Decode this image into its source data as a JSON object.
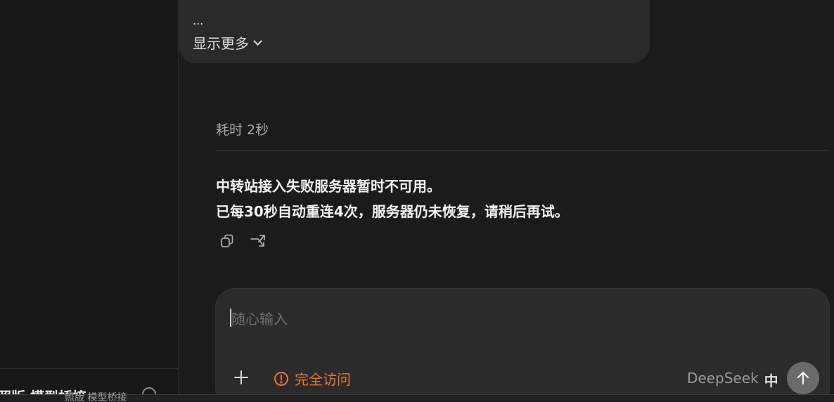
{
  "sidebar": {
    "bottom_label": "照版 模型桥接"
  },
  "taskbar": {
    "strip_text": "照版 模型桥接"
  },
  "previous_message": {
    "ellipsis": "...",
    "show_more": "显示更多"
  },
  "response": {
    "elapsed": "耗时 2秒",
    "lines": [
      "中转站接入失败服务器暂时不可用。",
      "已每30秒自动重连4次，服务器仍未恢复，请稍后再试。"
    ]
  },
  "composer": {
    "placeholder": "随心输入",
    "value": "",
    "access_label": "完全访问",
    "model_name": "DeepSeek",
    "language": "中"
  },
  "colors": {
    "accent_orange": "#e5743b",
    "background": "#1b1b1b",
    "composer_bg": "#2b2b2b"
  },
  "icons": {
    "copy": "copy-icon",
    "branch": "branch-icon",
    "plus": "plus-icon",
    "warning": "warning-circle-icon",
    "send": "arrow-up-icon",
    "chevron": "chevron-down-icon"
  }
}
